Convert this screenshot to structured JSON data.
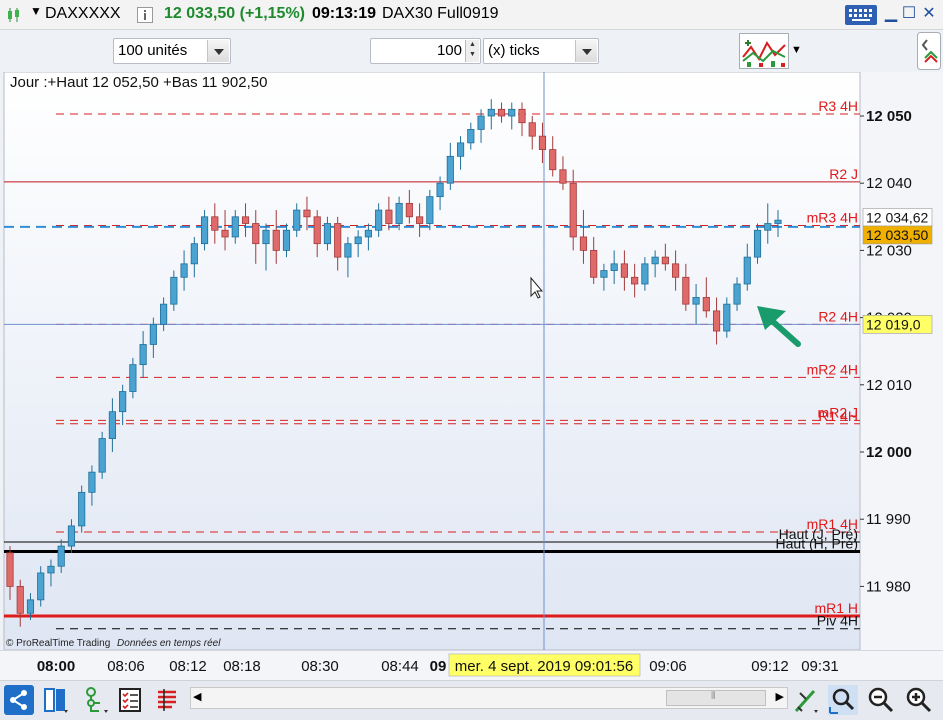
{
  "titlebar": {
    "symbol": "DAXXXXX",
    "price_change": "12 033,50 (+1,15%)",
    "time": "09:13:19",
    "instrument": "DAX30 Full0919"
  },
  "toolbar": {
    "units_select": "100 unités",
    "ticks_value": "100",
    "ticks_select": "(x) ticks"
  },
  "chart": {
    "info_text": "Jour :+Haut 12 052,50 +Bas 11 902,50",
    "copyright": "© ProRealTime Trading",
    "data_note": "Données en temps réel",
    "crosshair_label": "mer. 4 sept. 2019 09:01:56",
    "price_label_last": "12 034,62",
    "price_label_current": "12 033,50",
    "price_label_cursor": "12 019,0"
  },
  "chart_data": {
    "type": "candlestick",
    "y_ticks": [
      "12 050",
      "12 040",
      "12 030",
      "12 020",
      "12 010",
      "12 000",
      "11 990",
      "11 980"
    ],
    "x_ticks": [
      "08:00",
      "08:06",
      "08:12",
      "08:18",
      "08:30",
      "08:44",
      "09",
      "09:06",
      "09:12",
      "09:31"
    ],
    "ylim": [
      11972,
      12062
    ],
    "levels": [
      {
        "label": "R3 4H",
        "value": 12050.3,
        "style": "dashed",
        "color": "#d62020"
      },
      {
        "label": "R2 J",
        "value": 12040.2,
        "style": "solid",
        "color": "#c0141e"
      },
      {
        "label": "mR3 4H",
        "value": 12033.7,
        "style": "dashed",
        "color": "#d62020"
      },
      {
        "label": "R2 4H",
        "value": 12019.0,
        "style": "dashed",
        "color": "#d62020"
      },
      {
        "label": "mR2 4H",
        "value": 12011.1,
        "style": "dashed",
        "color": "#d62020"
      },
      {
        "label": "mR2 J",
        "value": 12004.7,
        "style": "dashed",
        "color": "#d62020"
      },
      {
        "label": "R1 4H",
        "value": 12004.2,
        "style": "dashed",
        "color": "#d62020"
      },
      {
        "label": "mR1 4H",
        "value": 11988.1,
        "style": "dashed",
        "color": "#d62020"
      },
      {
        "label": "Haut (J, Pré)",
        "value": 11986.6,
        "style": "solid",
        "color": "#000000"
      },
      {
        "label": "Haut (H, Pré)",
        "value": 11985.2,
        "style": "solid-thick",
        "color": "#000000"
      },
      {
        "label": "mR1 H",
        "value": 11975.6,
        "style": "solid-thick",
        "color": "#e01a1a"
      },
      {
        "label": "Piv 4H",
        "value": 11973.7,
        "style": "dashed",
        "color": "#000000"
      }
    ],
    "candles": [
      [
        11985.0,
        11986.0,
        11978.0,
        11980.0
      ],
      [
        11980.0,
        11981.0,
        11974.0,
        11976.0
      ],
      [
        11976.0,
        11979.0,
        11975.0,
        11978.0
      ],
      [
        11978.0,
        11983.0,
        11977.0,
        11982.0
      ],
      [
        11982.0,
        11984.0,
        11980.0,
        11983.0
      ],
      [
        11983.0,
        11987.0,
        11982.0,
        11986.0
      ],
      [
        11986.0,
        11990.0,
        11985.0,
        11989.0
      ],
      [
        11989.0,
        11995.0,
        11988.0,
        11994.0
      ],
      [
        11994.0,
        11998.0,
        11992.0,
        11997.0
      ],
      [
        11997.0,
        12003.0,
        11996.0,
        12002.0
      ],
      [
        12002.0,
        12008.0,
        12000.0,
        12006.0
      ],
      [
        12006.0,
        12010.0,
        12004.0,
        12009.0
      ],
      [
        12009.0,
        12014.0,
        12008.0,
        12013.0
      ],
      [
        12013.0,
        12018.0,
        12011.0,
        12016.0
      ],
      [
        12016.0,
        12020.0,
        12014.0,
        12019.0
      ],
      [
        12019.0,
        12023.0,
        12018.0,
        12022.0
      ],
      [
        12022.0,
        12027.0,
        12021.0,
        12026.0
      ],
      [
        12026.0,
        12030.0,
        12024.0,
        12028.0
      ],
      [
        12028.0,
        12032.0,
        12026.0,
        12031.0
      ],
      [
        12031.0,
        12036.0,
        12030.0,
        12035.0
      ],
      [
        12035.0,
        12037.0,
        12031.0,
        12033.0
      ],
      [
        12033.0,
        12036.0,
        12030.0,
        12032.0
      ],
      [
        12032.0,
        12036.0,
        12031.0,
        12035.0
      ],
      [
        12035.0,
        12037.0,
        12032.0,
        12034.0
      ],
      [
        12034.0,
        12036.0,
        12028.0,
        12031.0
      ],
      [
        12031.0,
        12034.0,
        12027.0,
        12033.0
      ],
      [
        12033.0,
        12036.0,
        12028.0,
        12030.0
      ],
      [
        12030.0,
        12034.0,
        12029.0,
        12033.0
      ],
      [
        12033.0,
        12037.0,
        12032.0,
        12036.0
      ],
      [
        12036.0,
        12038.0,
        12033.0,
        12035.0
      ],
      [
        12035.0,
        12036.0,
        12029.0,
        12031.0
      ],
      [
        12031.0,
        12035.0,
        12030.0,
        12034.0
      ],
      [
        12034.0,
        12035.0,
        12027.0,
        12029.0
      ],
      [
        12029.0,
        12032.0,
        12026.0,
        12031.0
      ],
      [
        12031.0,
        12033.0,
        12029.0,
        12032.0
      ],
      [
        12032.0,
        12034.0,
        12030.0,
        12033.0
      ],
      [
        12033.0,
        12037.0,
        12032.0,
        12036.0
      ],
      [
        12036.0,
        12038.0,
        12033.0,
        12034.0
      ],
      [
        12034.0,
        12038.0,
        12033.0,
        12037.0
      ],
      [
        12037.0,
        12039.0,
        12034.0,
        12035.0
      ],
      [
        12035.0,
        12037.0,
        12032.0,
        12034.0
      ],
      [
        12034.0,
        12039.0,
        12033.0,
        12038.0
      ],
      [
        12038.0,
        12041.0,
        12036.0,
        12040.0
      ],
      [
        12040.0,
        12046.0,
        12039.0,
        12044.0
      ],
      [
        12044.0,
        12047.0,
        12042.0,
        12046.0
      ],
      [
        12046.0,
        12049.0,
        12045.0,
        12048.0
      ],
      [
        12048.0,
        12051.0,
        12046.0,
        12050.0
      ],
      [
        12050.0,
        12052.5,
        12048.0,
        12051.0
      ],
      [
        12051.0,
        12052.0,
        12049.0,
        12050.0
      ],
      [
        12050.0,
        12052.0,
        12048.0,
        12051.0
      ],
      [
        12051.0,
        12052.0,
        12047.0,
        12049.0
      ],
      [
        12049.0,
        12050.0,
        12045.0,
        12047.0
      ],
      [
        12047.0,
        12049.0,
        12043.0,
        12045.0
      ],
      [
        12045.0,
        12047.0,
        12041.0,
        12042.0
      ],
      [
        12042.0,
        12044.0,
        12039.0,
        12040.0
      ],
      [
        12040.0,
        12042.0,
        12030.0,
        12032.0
      ],
      [
        12032.0,
        12036.0,
        12028.0,
        12030.0
      ],
      [
        12030.0,
        12032.0,
        12025.0,
        12026.0
      ],
      [
        12026.0,
        12028.0,
        12024.0,
        12027.0
      ],
      [
        12027.0,
        12030.0,
        12025.0,
        12028.0
      ],
      [
        12028.0,
        12030.0,
        12024.0,
        12026.0
      ],
      [
        12026.0,
        12028.0,
        12023.0,
        12025.0
      ],
      [
        12025.0,
        12029.0,
        12024.0,
        12028.0
      ],
      [
        12028.0,
        12030.0,
        12026.0,
        12029.0
      ],
      [
        12029.0,
        12031.0,
        12027.0,
        12028.0
      ],
      [
        12028.0,
        12030.0,
        12024.0,
        12026.0
      ],
      [
        12026.0,
        12028.0,
        12021.0,
        12022.0
      ],
      [
        12022.0,
        12025.0,
        12019.0,
        12023.0
      ],
      [
        12023.0,
        12026.0,
        12020.0,
        12021.0
      ],
      [
        12021.0,
        12023.0,
        12016.0,
        12018.0
      ],
      [
        12018.0,
        12023.0,
        12017.0,
        12022.0
      ],
      [
        12022.0,
        12026.0,
        12021.0,
        12025.0
      ],
      [
        12025.0,
        12031.0,
        12024.0,
        12029.0
      ],
      [
        12029.0,
        12034.0,
        12028.0,
        12033.0
      ],
      [
        12033.0,
        12037.0,
        12031.0,
        12034.0
      ],
      [
        12034.0,
        12036.0,
        12032.0,
        12034.5
      ]
    ]
  },
  "icons": {
    "bottom": [
      "share-icon",
      "layout-icon",
      "tree-icon",
      "checklist-icon",
      "list-edit-icon",
      "scroll-left-icon",
      "scroll-right-icon",
      "draw-tools-icon",
      "zoom-fit-icon",
      "zoom-out-icon",
      "zoom-in-icon"
    ]
  }
}
